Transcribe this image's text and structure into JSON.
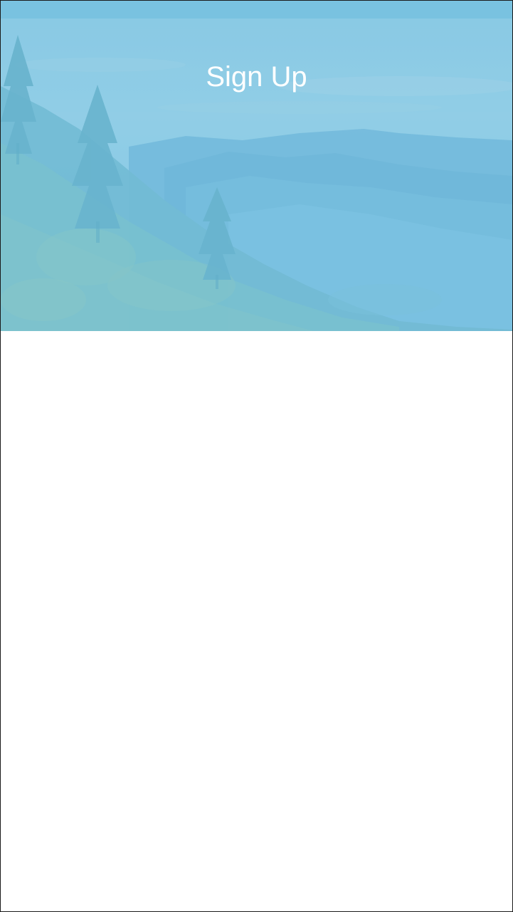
{
  "header": {
    "title": "Sign Up",
    "background_image": "misty-mountain-forest",
    "overlay_color": "#7cc3e3"
  },
  "status_bar": {
    "color": "#79c2e0"
  },
  "content": {
    "background_color": "#ffffff"
  }
}
